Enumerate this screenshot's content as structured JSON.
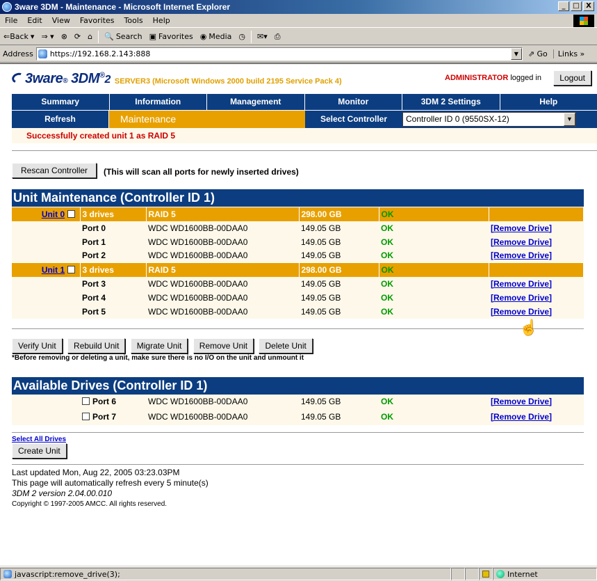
{
  "window": {
    "title": "3ware 3DM - Maintenance - Microsoft Internet Explorer",
    "controls": [
      "_",
      "□",
      "X"
    ]
  },
  "menu": [
    "File",
    "Edit",
    "View",
    "Favorites",
    "Tools",
    "Help"
  ],
  "toolbar": {
    "back": "⇐Back",
    "search": "Search",
    "favorites": "Favorites",
    "media": "Media"
  },
  "address": {
    "label": "Address",
    "url": "https://192.168.2.143:888",
    "go": "Go",
    "links": "Links"
  },
  "header": {
    "logo": "3ware",
    "product": "3DM",
    "product_suffix": "2",
    "server": "SERVER3 (Microsoft Windows 2000 build 2195 Service Pack 4)",
    "user": "ADMINISTRATOR",
    "logged_in": "logged in",
    "logout": "Logout"
  },
  "nav": {
    "top": [
      "Summary",
      "Information",
      "Management",
      "Monitor",
      "3DM 2 Settings",
      "Help"
    ],
    "refresh": "Refresh",
    "current": "Maintenance",
    "select_label": "Select Controller",
    "select_value": "Controller ID 0 (9550SX-12)"
  },
  "message": "Successfully created unit 1 as RAID 5",
  "rescan": {
    "button": "Rescan Controller",
    "note": "(This will scan all ports for newly inserted drives)"
  },
  "unit_maintenance": {
    "title": "Unit Maintenance (Controller ID 1)",
    "units": [
      {
        "name": "Unit 0",
        "drives": "3 drives",
        "raid": "RAID 5",
        "size": "298.00 GB",
        "status": "OK",
        "ports": [
          {
            "port": "Port 0",
            "model": "WDC WD1600BB-00DAA0",
            "size": "149.05 GB",
            "status": "OK",
            "action": "[Remove Drive]"
          },
          {
            "port": "Port 1",
            "model": "WDC WD1600BB-00DAA0",
            "size": "149.05 GB",
            "status": "OK",
            "action": "[Remove Drive]"
          },
          {
            "port": "Port 2",
            "model": "WDC WD1600BB-00DAA0",
            "size": "149.05 GB",
            "status": "OK",
            "action": "[Remove Drive]"
          }
        ]
      },
      {
        "name": "Unit 1",
        "drives": "3 drives",
        "raid": "RAID 5",
        "size": "298.00 GB",
        "status": "OK",
        "ports": [
          {
            "port": "Port 3",
            "model": "WDC WD1600BB-00DAA0",
            "size": "149.05 GB",
            "status": "OK",
            "action": "[Remove Drive]"
          },
          {
            "port": "Port 4",
            "model": "WDC WD1600BB-00DAA0",
            "size": "149.05 GB",
            "status": "OK",
            "action": "[Remove Drive]"
          },
          {
            "port": "Port 5",
            "model": "WDC WD1600BB-00DAA0",
            "size": "149.05 GB",
            "status": "OK",
            "action": "[Remove Drive]"
          }
        ]
      }
    ],
    "buttons": [
      "Verify Unit",
      "Rebuild Unit",
      "Migrate Unit",
      "Remove Unit",
      "Delete Unit"
    ],
    "warning": "*Before removing or deleting a unit, make sure there is no I/O on the unit and unmount it"
  },
  "available": {
    "title": "Available Drives (Controller ID 1)",
    "drives": [
      {
        "port": "Port 6",
        "model": "WDC WD1600BB-00DAA0",
        "size": "149.05 GB",
        "status": "OK",
        "action": "[Remove Drive]"
      },
      {
        "port": "Port 7",
        "model": "WDC WD1600BB-00DAA0",
        "size": "149.05 GB",
        "status": "OK",
        "action": "[Remove Drive]"
      }
    ],
    "select_all": "Select All Drives",
    "create": "Create Unit"
  },
  "footer": {
    "updated": "Last updated Mon, Aug 22, 2005 03:23.03PM",
    "refresh_note": "This page will automatically refresh every 5 minute(s)",
    "version": "3DM 2 version 2.04.00.010",
    "copyright": "Copyright © 1997-2005 AMCC. All rights reserved."
  },
  "status": {
    "text": "javascript:remove_drive(3);",
    "zone": "Internet"
  },
  "colors": {
    "navy": "#0c3d80",
    "orange": "#e8a000",
    "ok_green": "#009900",
    "link_blue": "#0000cc",
    "error_red": "#cc0000"
  }
}
